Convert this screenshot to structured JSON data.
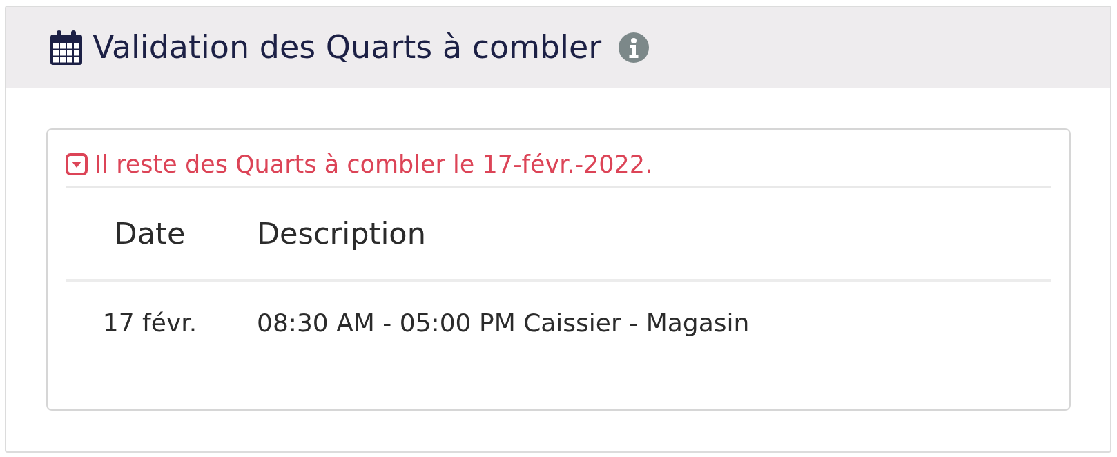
{
  "panel": {
    "title": "Validation des Quarts à combler"
  },
  "alert": {
    "message": "Il reste des Quarts à combler le 17-févr.-2022."
  },
  "table": {
    "columns": [
      "Date",
      "Description"
    ],
    "rows": [
      {
        "date": "17 févr.",
        "description": "08:30 AM - 05:00 PM Caissier - Magasin"
      }
    ]
  }
}
